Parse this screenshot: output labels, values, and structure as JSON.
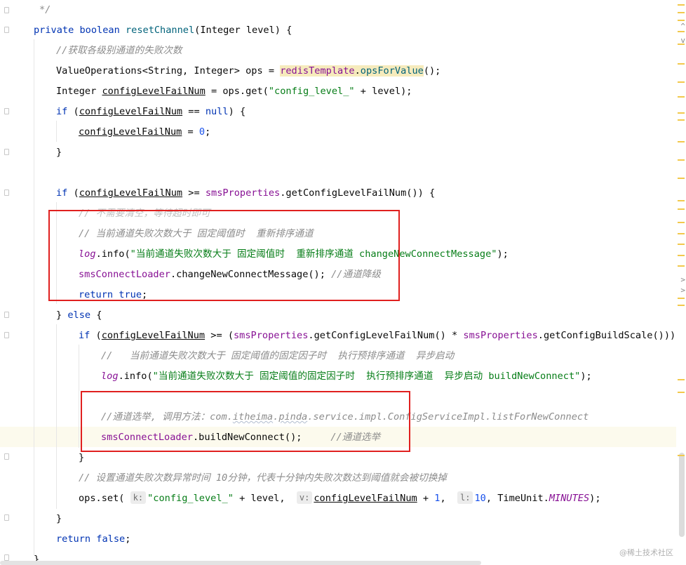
{
  "code": {
    "l01": "*/",
    "l02": {
      "kw1": "private boolean",
      "name": "resetChannel",
      "rest": "(Integer level) {"
    },
    "l03": "//获取各级别通道的失败次数",
    "l04": {
      "a": "ValueOperations<String, Integer> ops = ",
      "b": "redisTemplate",
      "c": ".",
      "d": "opsForValue",
      "e": "();"
    },
    "l05": {
      "a": "Integer ",
      "b": "configLevelFailNum",
      "c": " = ops.get(",
      "d": "\"config_level_\"",
      "e": " + level);"
    },
    "l06": {
      "a": "if",
      "b": " (",
      "c": "configLevelFailNum",
      "d": " == ",
      "e": "null",
      "f": ") {"
    },
    "l07": {
      "a": "configLevelFailNum",
      "b": " = ",
      "c": "0",
      "d": ";"
    },
    "l08": "}",
    "l09": {
      "a": "if",
      "b": " (",
      "c": "configLevelFailNum",
      "d": " >= ",
      "e": "smsProperties",
      "f": ".getConfigLevelFailNum()) {"
    },
    "l10": "// 不需要清空，等待超时即可",
    "l11": "// 当前通道失败次数大于 固定阈值时  重新排序通道",
    "l12": {
      "a": "log",
      "b": ".info(",
      "c": "\"当前通道失败次数大于 固定阈值时  重新排序通道 changeNewConnectMessage\"",
      "d": ");"
    },
    "l13": {
      "a": "smsConnectLoader",
      "b": ".changeNewConnectMessage(); ",
      "c": "//通道降级"
    },
    "l14": {
      "a": "return true",
      "b": ";"
    },
    "l15": {
      "a": "} ",
      "b": "else",
      "c": " {"
    },
    "l16": {
      "a": "if",
      "b": " (",
      "c": "configLevelFailNum",
      "d": " >= (",
      "e": "smsProperties",
      "f": ".getConfigLevelFailNum() * ",
      "g": "smsProperties",
      "h": ".getConfigBuildScale())) {"
    },
    "l17": "//   当前通道失败次数大于 固定阈值的固定因子时  执行预排序通道  异步启动",
    "l18": {
      "a": "log",
      "b": ".info(",
      "c": "\"当前通道失败次数大于 固定阈值的固定因子时  执行预排序通道  异步启动 buildNewConnect\"",
      "d": ");"
    },
    "l19": {
      "a": "//通道选举, 调用方法：com.",
      "b": "itheima",
      "c": ".",
      "d": "pinda",
      "e": ".service.impl.ConfigServiceImpl.listForNewConnect"
    },
    "l20": {
      "a": "smsConnectLoader",
      "b": ".buildNewConnect();     ",
      "c": "//通道选举"
    },
    "l21": "}",
    "l22": "// 设置通道失败次数异常时间 10分钟，代表十分钟内失败次数达到阈值就会被切换掉",
    "l23": {
      "a": "ops.set( ",
      "h1": "k:",
      "b": "\"config_level_\"",
      "c": " + level,  ",
      "h2": "v:",
      "d": "configLevelFailNum",
      "e": " + ",
      "f": "1",
      "g": ",  ",
      "h3": "l:",
      "i": "10",
      "j": ", TimeUnit.",
      "k": "MINUTES",
      "l": ");"
    },
    "l24": "}",
    "l25": {
      "a": "return false",
      "b": ";"
    },
    "l26": "}"
  },
  "watermark": "@稀土技术社区",
  "colors": {
    "keyword": "#0033b3",
    "string": "#067d17",
    "number": "#1750eb",
    "comment": "#8c8c8c",
    "field": "#871094",
    "annotation_box": "#e0201f"
  }
}
